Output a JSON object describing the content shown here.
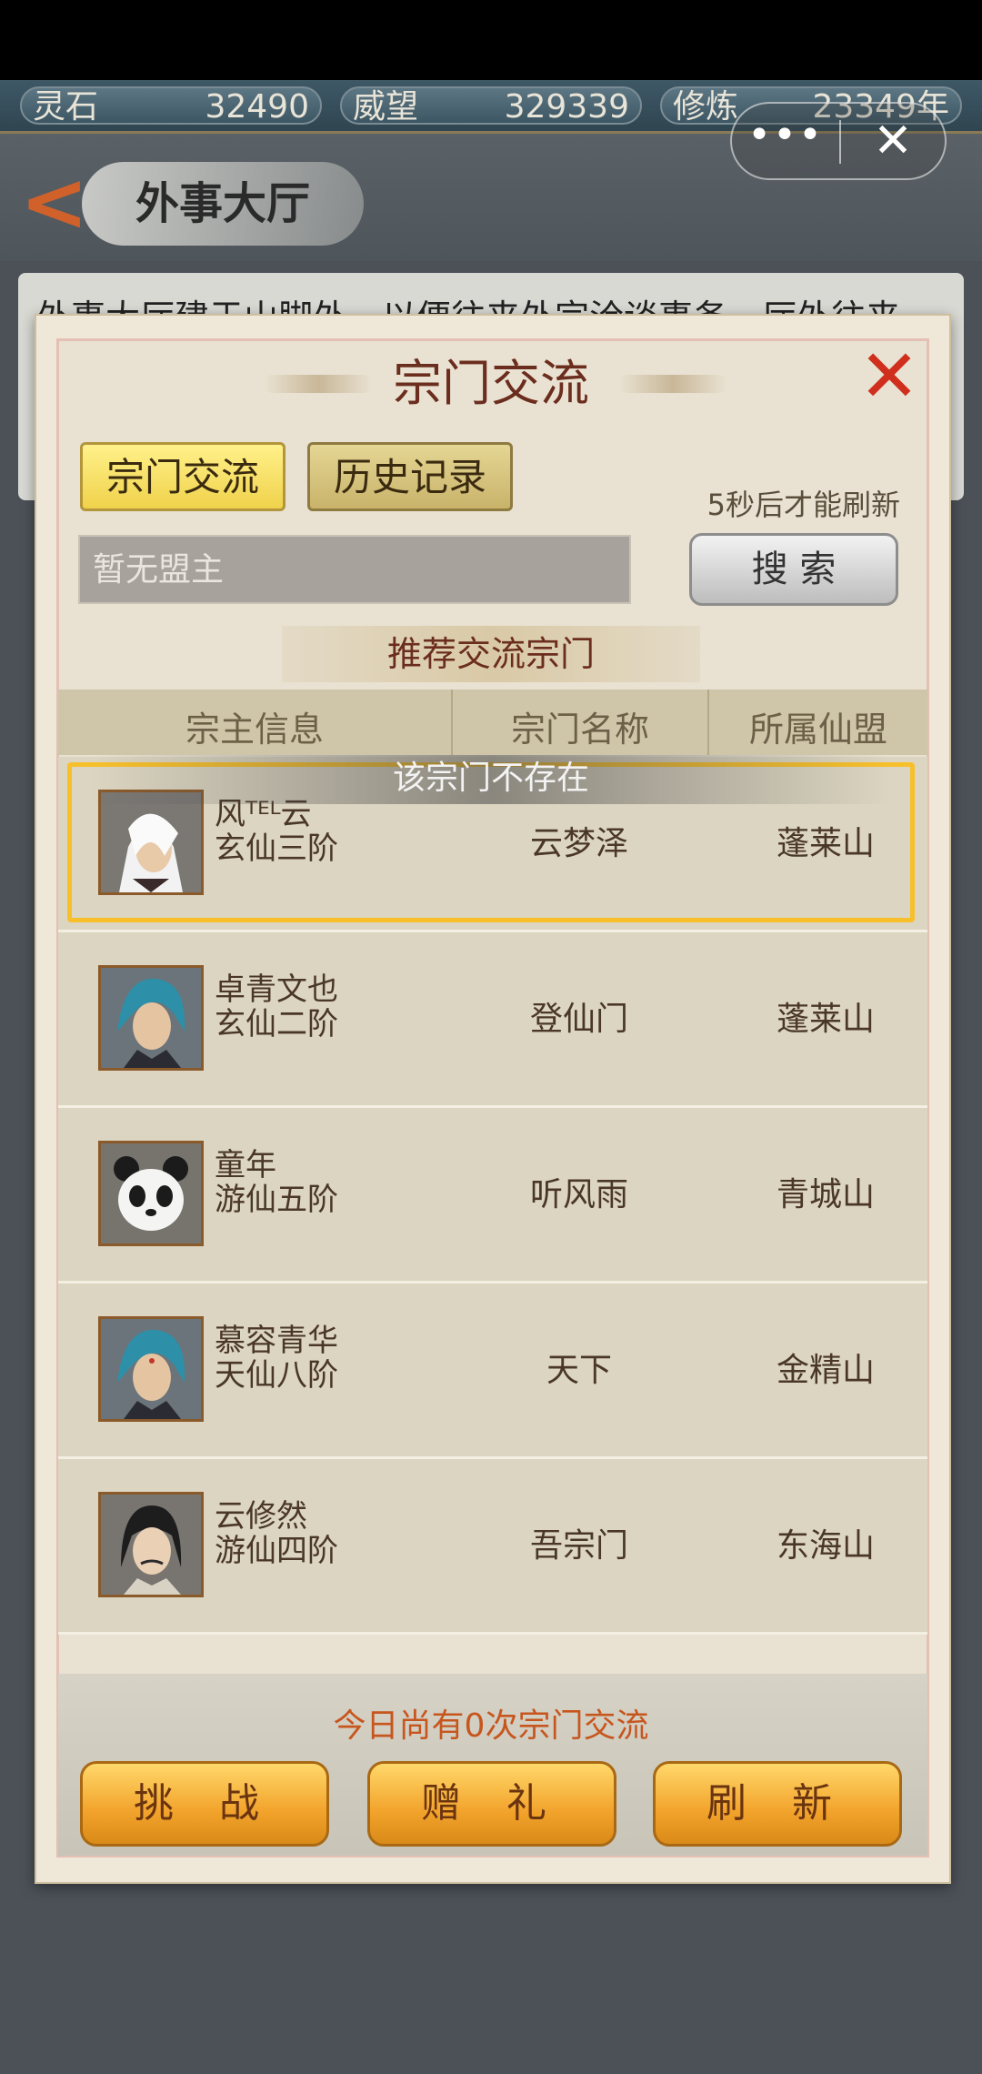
{
  "resources": [
    {
      "label": "灵石",
      "value": "32490"
    },
    {
      "label": "威望",
      "value": "329339"
    },
    {
      "label": "修炼",
      "value": "23349年"
    }
  ],
  "capsule": {
    "more": "•••",
    "close": "✕"
  },
  "hall": {
    "title": "外事大厅",
    "back_icon": "back-arrow-icon",
    "banner_text": "外事大厅建于山脚外，以便往来外宗洽谈事务，厅外往来"
  },
  "modal": {
    "title": "宗门交流",
    "close": "✕",
    "tabs": [
      {
        "label": "宗门交流",
        "active": true
      },
      {
        "label": "历史记录",
        "active": false
      }
    ],
    "refresh_hint": "5秒后才能刷新",
    "search": {
      "value": "暂无盟主",
      "button": "搜 索"
    },
    "recommend_title": "推荐交流宗门",
    "columns": [
      "宗主信息",
      "宗门名称",
      "所属仙盟"
    ],
    "toast": "该宗门不存在",
    "rows": [
      {
        "name": "风ᵀᴱᴸ云",
        "rank": "玄仙三阶",
        "sect": "云梦泽",
        "alliance": "蓬莱山",
        "avatar": "white-hair-avatar",
        "selected": true
      },
      {
        "name": "卓青文也",
        "rank": "玄仙二阶",
        "sect": "登仙门",
        "alliance": "蓬莱山",
        "avatar": "blue-hair-avatar",
        "selected": false
      },
      {
        "name": "童年",
        "rank": "游仙五阶",
        "sect": "听风雨",
        "alliance": "青城山",
        "avatar": "panda-avatar",
        "selected": false
      },
      {
        "name": "慕容青华",
        "rank": "天仙八阶",
        "sect": "天下",
        "alliance": "金精山",
        "avatar": "blue-hair-avatar",
        "selected": false
      },
      {
        "name": "云修然",
        "rank": "游仙四阶",
        "sect": "吾宗门",
        "alliance": "东海山",
        "avatar": "black-hair-avatar",
        "selected": false
      }
    ],
    "daily_count": "今日尚有0次宗门交流",
    "buttons": [
      "挑 战",
      "赠 礼",
      "刷 新"
    ]
  },
  "colors": {
    "accent_title": "#6b2d1e",
    "button_orange": "#f2a32b",
    "highlight": "#f7c02b",
    "close_red": "#cf2f1c"
  }
}
